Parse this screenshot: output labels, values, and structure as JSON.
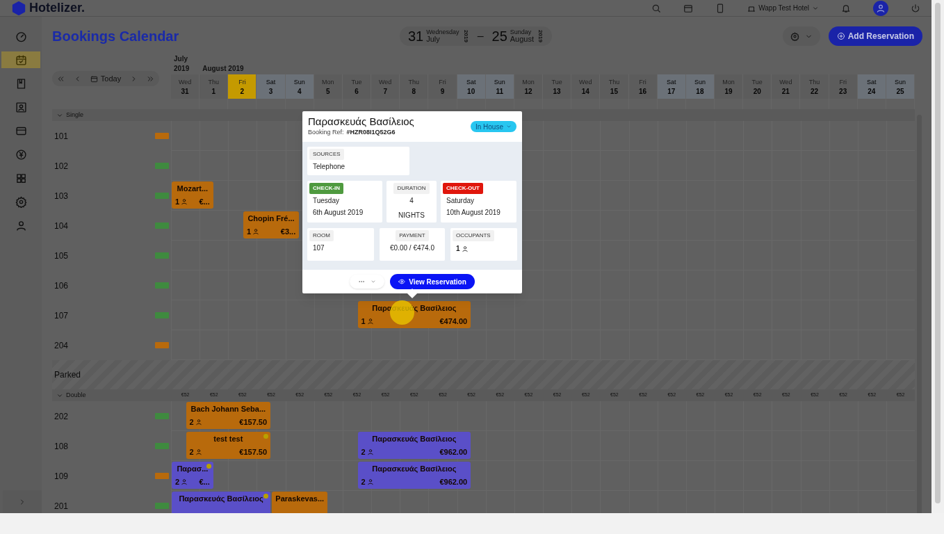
{
  "topbar": {
    "logo": "Hotelizer.",
    "hotel": "Wapp Test Hotel"
  },
  "sidebar": {
    "items": [
      {
        "kind": "dashboard",
        "selected": false
      },
      {
        "kind": "calendar",
        "selected": true
      },
      {
        "kind": "book",
        "selected": false
      },
      {
        "kind": "frame",
        "selected": false
      },
      {
        "kind": "card",
        "selected": false
      },
      {
        "kind": "yen",
        "selected": false
      },
      {
        "kind": "grid",
        "selected": false
      },
      {
        "kind": "settings",
        "selected": false
      },
      {
        "kind": "user",
        "selected": false
      }
    ]
  },
  "header": {
    "title": "Bookings Calendar",
    "range_start": {
      "day": "31",
      "weekday": "Wednesday",
      "month": "July",
      "year": "2019"
    },
    "range_separator": "–",
    "range_end": {
      "day": "25",
      "weekday": "Sunday",
      "month": "August",
      "year": "2019"
    },
    "add_button": "Add Reservation"
  },
  "calendar": {
    "today_button": "Today",
    "months": [
      "July 2019",
      "August 2019"
    ],
    "days": [
      {
        "weekday": "Wed",
        "day": "31",
        "weekend": false,
        "selected": false
      },
      {
        "weekday": "Thu",
        "day": "1",
        "weekend": false,
        "selected": false
      },
      {
        "weekday": "Fri",
        "day": "2",
        "weekend": false,
        "selected": true
      },
      {
        "weekday": "Sat",
        "day": "3",
        "weekend": true,
        "selected": false
      },
      {
        "weekday": "Sun",
        "day": "4",
        "weekend": true,
        "selected": false
      },
      {
        "weekday": "Mon",
        "day": "5",
        "weekend": false,
        "selected": false
      },
      {
        "weekday": "Tue",
        "day": "6",
        "weekend": false,
        "selected": false
      },
      {
        "weekday": "Wed",
        "day": "7",
        "weekend": false,
        "selected": false
      },
      {
        "weekday": "Thu",
        "day": "8",
        "weekend": false,
        "selected": false
      },
      {
        "weekday": "Fri",
        "day": "9",
        "weekend": false,
        "selected": false
      },
      {
        "weekday": "Sat",
        "day": "10",
        "weekend": true,
        "selected": false
      },
      {
        "weekday": "Sun",
        "day": "11",
        "weekend": true,
        "selected": false
      },
      {
        "weekday": "Mon",
        "day": "12",
        "weekend": false,
        "selected": false
      },
      {
        "weekday": "Tue",
        "day": "13",
        "weekend": false,
        "selected": false
      },
      {
        "weekday": "Wed",
        "day": "14",
        "weekend": false,
        "selected": false
      },
      {
        "weekday": "Thu",
        "day": "15",
        "weekend": false,
        "selected": false
      },
      {
        "weekday": "Fri",
        "day": "16",
        "weekend": false,
        "selected": false
      },
      {
        "weekday": "Sat",
        "day": "17",
        "weekend": true,
        "selected": false
      },
      {
        "weekday": "Sun",
        "day": "18",
        "weekend": true,
        "selected": false
      },
      {
        "weekday": "Mon",
        "day": "19",
        "weekend": false,
        "selected": false
      },
      {
        "weekday": "Tue",
        "day": "20",
        "weekend": false,
        "selected": false
      },
      {
        "weekday": "Wed",
        "day": "21",
        "weekend": false,
        "selected": false
      },
      {
        "weekday": "Thu",
        "day": "22",
        "weekend": false,
        "selected": false
      },
      {
        "weekday": "Fri",
        "day": "23",
        "weekend": false,
        "selected": false
      },
      {
        "weekday": "Sat",
        "day": "24",
        "weekend": true,
        "selected": false
      },
      {
        "weekday": "Sun",
        "day": "25",
        "weekend": true,
        "selected": false
      }
    ]
  },
  "sections": [
    {
      "kind": "group",
      "name": "Single",
      "expanded": true,
      "rooms": [
        {
          "number": "101",
          "color": "#b86a0c"
        },
        {
          "number": "102",
          "color": "#3f8a3f"
        },
        {
          "number": "103",
          "color": "#3f8a3f",
          "bookings": [
            {
              "guest": "Mozart...",
              "guests": "1",
              "price": "€...",
              "color": "#b86a0c",
              "flag": false
            }
          ]
        },
        {
          "number": "104",
          "color": "#3f8a3f",
          "bookings": [
            {
              "guest": "Chopin Fré...",
              "guests": "1",
              "price": "€3...",
              "color": "#b86a0c",
              "flag": false
            }
          ]
        },
        {
          "number": "105",
          "color": "#3f8a3f"
        },
        {
          "number": "106",
          "color": "#3f8a3f"
        },
        {
          "number": "107",
          "color": "#3f8a3f",
          "bookings": [
            {
              "guest": "Παρασκευάς Βασίλειος",
              "guests": "1",
              "price": "€474.00",
              "color": "#b86a0c",
              "flag": false
            }
          ]
        },
        {
          "number": "204",
          "color": "#b86a0c"
        }
      ]
    },
    {
      "kind": "parked",
      "name": "Parked"
    },
    {
      "kind": "group",
      "name": "Double",
      "expanded": true,
      "prices": [
        "€52",
        "€52",
        "€52",
        "€52",
        "€52",
        "€52",
        "€52",
        "€52",
        "€52",
        "€52",
        "€52",
        "€52",
        "€52",
        "€52",
        "€52",
        "€52",
        "€52",
        "€52",
        "€52",
        "€52",
        "€52",
        "€52",
        "€52",
        "€52",
        "€52",
        "€52"
      ],
      "rooms": [
        {
          "number": "202",
          "color": "#3f8a3f",
          "bookings": [
            {
              "guest": "Bach Johann Seba...",
              "guests": "2",
              "price": "€157.50",
              "color": "#b86a0c",
              "flag": false
            }
          ]
        },
        {
          "number": "108",
          "color": "#3f8a3f",
          "bookings": [
            {
              "guest": "test test",
              "guests": "2",
              "price": "€157.50",
              "color": "#b86a0c",
              "flag": true
            },
            {
              "guest": "Παρασκευάς Βασίλειος",
              "guests": "2",
              "price": "€962.00",
              "color": "#5a4fc8",
              "flag": false
            }
          ]
        },
        {
          "number": "109",
          "color": "#b86a0c",
          "bookings": [
            {
              "guest": "Παρασ...",
              "guests": "2",
              "price": "€...",
              "color": "#5a4fc8",
              "flag": true
            },
            {
              "guest": "Παρασκευάς Βασίλειος",
              "guests": "2",
              "price": "€962.00",
              "color": "#5a4fc8",
              "flag": false
            }
          ]
        },
        {
          "number": "201",
          "color": "#3f8a3f",
          "bookings": [
            {
              "guest": "Παρασκευάς Βασίλειος",
              "color": "#5a4fc8",
              "flag": true
            },
            {
              "guest": "Paraskevas...",
              "color": "#b86a0c",
              "flag": false
            }
          ]
        }
      ]
    }
  ],
  "popup": {
    "guest": "Παρασκευάς Βασίλειος",
    "ref_label": "Booking Ref:",
    "ref": "#HZR08I1Q52G6",
    "status": "In House",
    "sources": {
      "label": "SOURCES",
      "value": "Telephone"
    },
    "check_in": {
      "label": "CHECK-IN",
      "weekday": "Tuesday",
      "date": "6th August 2019"
    },
    "duration": {
      "label": "DURATION",
      "value": "4",
      "unit": "NIGHTS"
    },
    "check_out": {
      "label": "CHECK-OUT",
      "weekday": "Saturday",
      "date": "10th August 2019"
    },
    "room": {
      "label": "ROOM",
      "value": "107"
    },
    "payment": {
      "label": "PAYMENT",
      "value": "€0.00 / €474.0"
    },
    "occupants": {
      "label": "OCCUPANTS",
      "value": "1"
    },
    "view_button": "View Reservation"
  }
}
